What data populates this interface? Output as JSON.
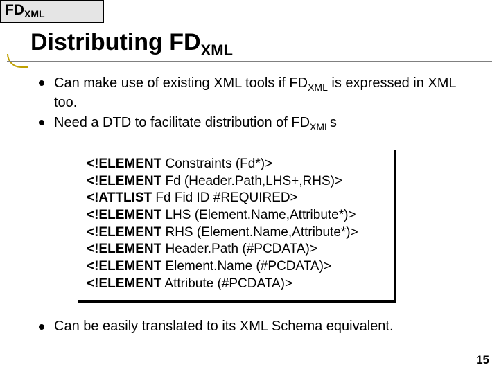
{
  "header": {
    "fd": "FD",
    "sub": "XML"
  },
  "title": {
    "pre": "Distributing FD",
    "sub": "XML"
  },
  "bullets_top": [
    {
      "before": "Can make use of existing XML tools if FD",
      "sub": "XML",
      "after": " is expressed in XML too."
    },
    {
      "before": "Need a DTD to facilitate distribution of FD",
      "sub": "XML",
      "after": "s"
    }
  ],
  "code": [
    {
      "kw": "<!ELEMENT",
      "rest": " Constraints (Fd*)>"
    },
    {
      "kw": "<!ELEMENT",
      "rest": " Fd (Header.Path,LHS+,RHS)>"
    },
    {
      "kw": "<!ATTLIST",
      "rest": " Fd Fid ID #REQUIRED>"
    },
    {
      "kw": "<!ELEMENT",
      "rest": " LHS (Element.Name,Attribute*)>"
    },
    {
      "kw": "<!ELEMENT",
      "rest": " RHS (Element.Name,Attribute*)>"
    },
    {
      "kw": "<!ELEMENT",
      "rest": " Header.Path (#PCDATA)>"
    },
    {
      "kw": "<!ELEMENT",
      "rest": " Element.Name (#PCDATA)>"
    },
    {
      "kw": "<!ELEMENT",
      "rest": " Attribute (#PCDATA)>"
    }
  ],
  "bullet_bottom": "Can be easily translated to its XML Schema equivalent.",
  "page_number": "15"
}
